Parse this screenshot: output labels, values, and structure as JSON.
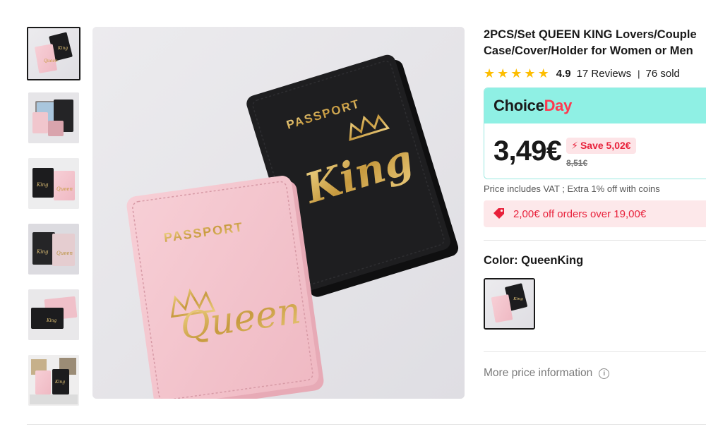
{
  "product": {
    "title_line1": "2PCS/Set QUEEN KING Lovers/Couple",
    "title_line2": "Case/Cover/Holder for Women or Men",
    "rating": "4.9",
    "reviews": "17 Reviews",
    "separator": "|",
    "sold": "76 sold",
    "star_count": 5
  },
  "image": {
    "left_passport_word": "PASSPORT",
    "left_passport_name": "Queen",
    "right_passport_word": "PASSPORT",
    "right_passport_name": "King"
  },
  "promo": {
    "brand_part1": "Choice",
    "brand_part2": "Day",
    "price": "3,49€",
    "save_label": "Save 5,02€",
    "old_price": "8,51€",
    "vat_note": "Price includes VAT ; Extra 1% off with coins",
    "coupon_text": "2,00€ off orders over 19,00€"
  },
  "variant": {
    "color_label": "Color: QueenKing"
  },
  "more": {
    "label": "More price information",
    "icon": "i"
  },
  "colors": {
    "choice_bg": "#8ff0e4",
    "accent_red": "#fd384f",
    "star": "#fdbd00",
    "pink_passport": "#f4c4cd",
    "black_passport": "#1c1c1e",
    "gold": "#c9a24a"
  }
}
